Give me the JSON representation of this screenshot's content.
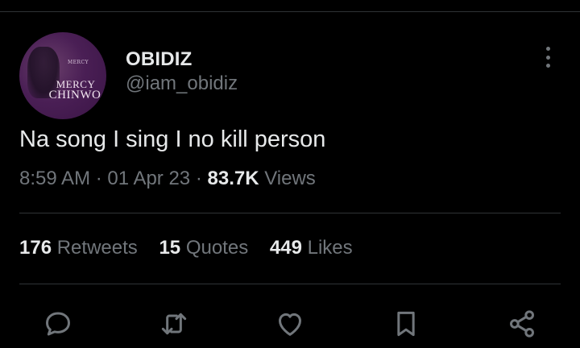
{
  "avatar": {
    "tiny_text": "MERCY",
    "line1": "MERCY",
    "line2": "CHINWO"
  },
  "user": {
    "display_name": "OBIDIZ",
    "handle": "@iam_obidiz"
  },
  "tweet": {
    "text": "Na song I sing I no kill person",
    "time": "8:59 AM",
    "date": "01 Apr 23",
    "views_count": "83.7K",
    "views_label": "Views",
    "separator": "·"
  },
  "stats": {
    "retweets_count": "176",
    "retweets_label": "Retweets",
    "quotes_count": "15",
    "quotes_label": "Quotes",
    "likes_count": "449",
    "likes_label": "Likes"
  },
  "actions": [
    "reply-icon",
    "retweet-icon",
    "like-icon",
    "bookmark-icon",
    "share-icon"
  ],
  "colors": {
    "background": "#000000",
    "text_primary": "#e7e9ea",
    "text_secondary": "#71767b",
    "divider": "#2f3336",
    "avatar_purple": "#4a1f55"
  }
}
